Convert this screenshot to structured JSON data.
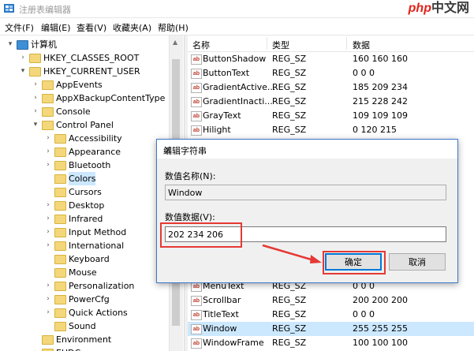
{
  "window": {
    "title": "注册表编辑器"
  },
  "brand": {
    "php": "php",
    "suffix": "中文网"
  },
  "menu": [
    "文件(F)",
    "编辑(E)",
    "查看(V)",
    "收藏夹(A)",
    "帮助(H)"
  ],
  "tree": [
    {
      "label": "计算机",
      "arrow": "▾",
      "depth": 0,
      "icon": "computer"
    },
    {
      "label": "HKEY_CLASSES_ROOT",
      "arrow": "›",
      "depth": 1
    },
    {
      "label": "HKEY_CURRENT_USER",
      "arrow": "▾",
      "depth": 1
    },
    {
      "label": "AppEvents",
      "arrow": "›",
      "depth": 2
    },
    {
      "label": "AppXBackupContentType",
      "arrow": "›",
      "depth": 2
    },
    {
      "label": "Console",
      "arrow": "›",
      "depth": 2
    },
    {
      "label": "Control Panel",
      "arrow": "▾",
      "depth": 2
    },
    {
      "label": "Accessibility",
      "arrow": "›",
      "depth": 3
    },
    {
      "label": "Appearance",
      "arrow": "›",
      "depth": 3
    },
    {
      "label": "Bluetooth",
      "arrow": "›",
      "depth": 3
    },
    {
      "label": "Colors",
      "arrow": "",
      "depth": 3,
      "selected": true
    },
    {
      "label": "Cursors",
      "arrow": "",
      "depth": 3
    },
    {
      "label": "Desktop",
      "arrow": "›",
      "depth": 3
    },
    {
      "label": "Infrared",
      "arrow": "›",
      "depth": 3
    },
    {
      "label": "Input Method",
      "arrow": "›",
      "depth": 3
    },
    {
      "label": "International",
      "arrow": "›",
      "depth": 3
    },
    {
      "label": "Keyboard",
      "arrow": "",
      "depth": 3
    },
    {
      "label": "Mouse",
      "arrow": "",
      "depth": 3
    },
    {
      "label": "Personalization",
      "arrow": "›",
      "depth": 3
    },
    {
      "label": "PowerCfg",
      "arrow": "›",
      "depth": 3
    },
    {
      "label": "Quick Actions",
      "arrow": "›",
      "depth": 3
    },
    {
      "label": "Sound",
      "arrow": "",
      "depth": 3
    },
    {
      "label": "Environment",
      "arrow": "",
      "depth": 2
    },
    {
      "label": "EUDC",
      "arrow": "›",
      "depth": 2
    }
  ],
  "list": {
    "headers": [
      "名称",
      "类型",
      "数据"
    ],
    "rows": [
      {
        "name": "ButtonShadow",
        "type": "REG_SZ",
        "data": "160 160 160"
      },
      {
        "name": "ButtonText",
        "type": "REG_SZ",
        "data": "0 0 0"
      },
      {
        "name": "GradientActive...",
        "type": "REG_SZ",
        "data": "185 209 234"
      },
      {
        "name": "GradientInacti...",
        "type": "REG_SZ",
        "data": "215 228 242"
      },
      {
        "name": "GrayText",
        "type": "REG_SZ",
        "data": "109 109 109"
      },
      {
        "name": "Hilight",
        "type": "REG_SZ",
        "data": "0 120 215"
      },
      {
        "name": "MenuText",
        "type": "REG_SZ",
        "data": "0 0 0"
      },
      {
        "name": "Scrollbar",
        "type": "REG_SZ",
        "data": "200 200 200"
      },
      {
        "name": "TitleText",
        "type": "REG_SZ",
        "data": "0 0 0"
      },
      {
        "name": "Window",
        "type": "REG_SZ",
        "data": "255 255 255",
        "selected": true
      },
      {
        "name": "WindowFrame",
        "type": "REG_SZ",
        "data": "100 100 100"
      }
    ],
    "icon_text": "ab"
  },
  "dialog": {
    "title": "编辑字符串",
    "name_label": "数值名称(N):",
    "name_value": "Window",
    "data_label": "数值数据(V):",
    "data_value": "202 234 206",
    "ok_label": "确定",
    "cancel_label": "取消",
    "close_glyph": "✕"
  },
  "colors": {
    "accent": "#0078d7",
    "highlight": "#e53935",
    "selection": "#cce8ff"
  }
}
